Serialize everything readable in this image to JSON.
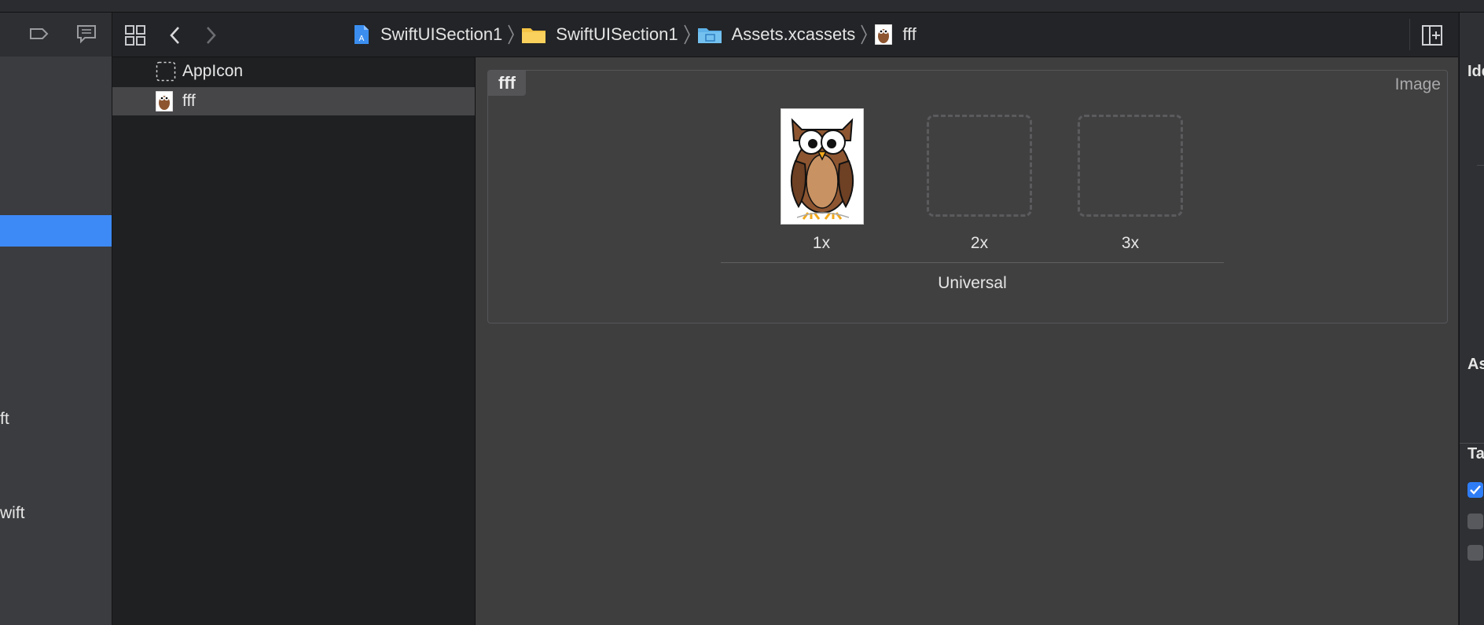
{
  "window": {
    "left_nav": {
      "fragments": [
        "ft",
        "wift"
      ]
    },
    "toolbar": {
      "grid_icon": "grid-icon",
      "back_icon": "chevron-left-icon",
      "forward_icon": "chevron-right-icon",
      "add_editor_icon": "split-editor-icon"
    },
    "breadcrumbs": [
      {
        "label": "SwiftUISection1",
        "icon": "project-icon"
      },
      {
        "label": "SwiftUISection1",
        "icon": "folder-icon"
      },
      {
        "label": "Assets.xcassets",
        "icon": "asset-catalog-icon"
      },
      {
        "label": "fff",
        "icon": "owl-thumbnail-icon"
      }
    ],
    "asset_list": [
      {
        "label": "AppIcon",
        "icon": "appicon-placeholder-icon",
        "selected": false
      },
      {
        "label": "fff",
        "icon": "owl-thumbnail-icon",
        "selected": true
      }
    ],
    "image_set": {
      "name": "fff",
      "type": "Image",
      "slots": [
        {
          "label": "1x",
          "filled": true
        },
        {
          "label": "2x",
          "filled": false
        },
        {
          "label": "3x",
          "filled": false
        }
      ],
      "idiom": "Universal"
    },
    "inspector": {
      "fragments": [
        "Ide",
        "As",
        "Ta"
      ],
      "checkboxes": [
        true,
        false,
        false
      ]
    },
    "colors": {
      "selection": "#3d8af7",
      "checkbox_on": "#2f7df6",
      "folder": "#f6c445",
      "catalog": "#5fb2e8"
    }
  }
}
